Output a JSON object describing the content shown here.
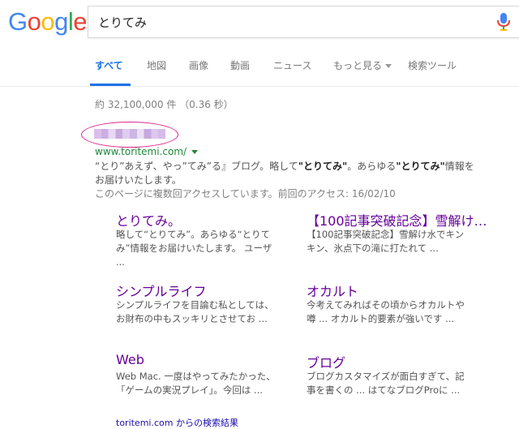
{
  "logo": {
    "letters": [
      "G",
      "o",
      "o",
      "g",
      "l",
      "e"
    ],
    "colors": [
      "#4285F4",
      "#EA4335",
      "#FBBC05",
      "#4285F4",
      "#34A853",
      "#EA4335"
    ]
  },
  "search": {
    "query": "とりてみ"
  },
  "tabs": [
    {
      "label": "すべて",
      "active": true
    },
    {
      "label": "地図"
    },
    {
      "label": "画像"
    },
    {
      "label": "動画"
    },
    {
      "label": "ニュース"
    },
    {
      "label": "もっと見る"
    },
    {
      "label": "検索ツール"
    }
  ],
  "result_stats": "約 32,100,000 件 （0.36 秒）",
  "result": {
    "url": "www.toritemi.com/",
    "snippet_parts": [
      "“とり”あえず、やっ”てみ”る』ブログ。略して",
      "\"とりてみ\"",
      "。あらゆる",
      "\"とりてみ\"",
      "情報をお届けいたします。"
    ],
    "visited": "このページに複数回アクセスしています。前回のアクセス: 16/02/10"
  },
  "sitelinks": [
    {
      "title": "とりてみ。",
      "desc": "略して“とりてみ”。あらゆる“とりてみ”情報をお届けいたします。 ユーザ ..."
    },
    {
      "title": "【100記事突破記念】雪解け…",
      "desc": "【100記事突破記念】雪解け水でキンキン、氷点下の滝に打たれて ..."
    },
    {
      "title": "シンプルライフ",
      "desc": "シンプルライフを目論む私としては、お財布の中もスッキリとさせてお ..."
    },
    {
      "title": "オカルト",
      "desc": "今考えてみればその頃からオカルトや噂 ... オカルト的要素が強いです ..."
    },
    {
      "title": "Web",
      "desc": "Web Mac. 一度はやってみたかった、「ゲームの実況プレイ」。今回は ..."
    },
    {
      "title": "ブログ",
      "desc": "ブログカスタマイズが面白すぎて、記事を書くの ... はてなブログProに ..."
    }
  ],
  "more_results": "toritemi.com からの検索結果"
}
